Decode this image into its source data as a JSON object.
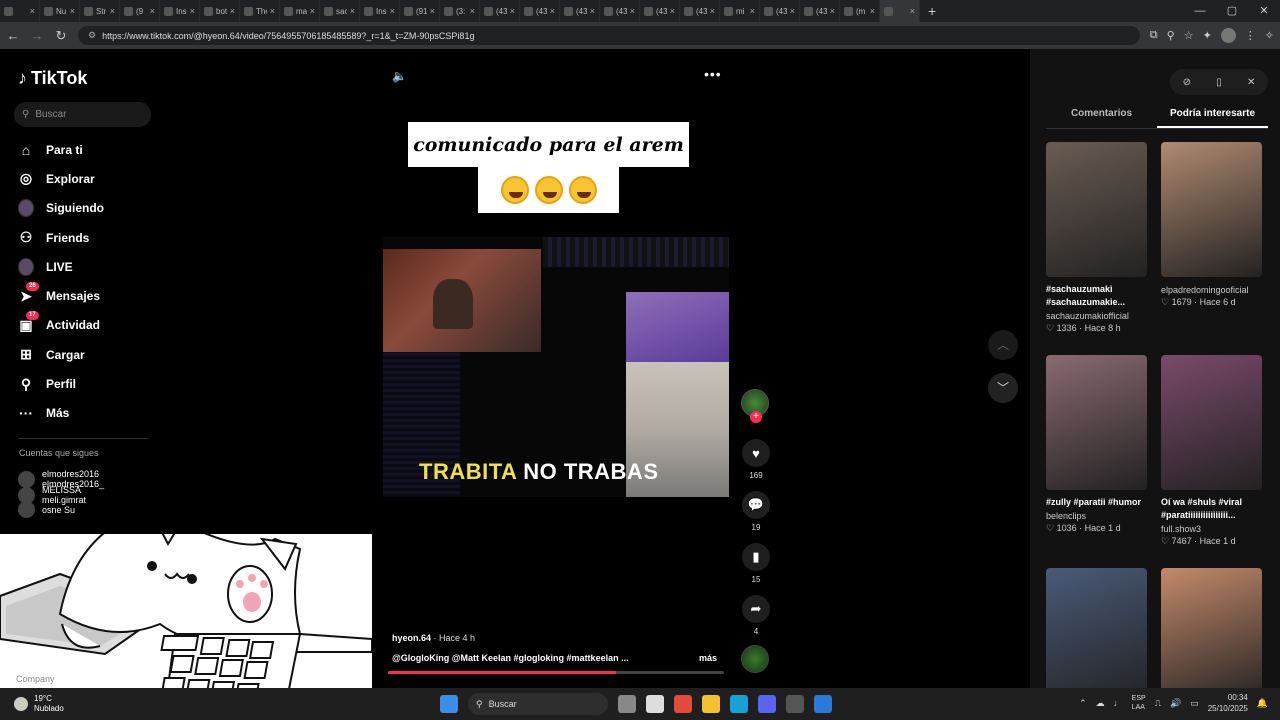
{
  "browser": {
    "tabs": [
      "",
      "Nu",
      "Str",
      "(9",
      "Ins",
      "bot",
      "The",
      "ma",
      "sac",
      "Ins",
      "(91",
      "(3:",
      "(43",
      "(43",
      "(43",
      "(43",
      "(43",
      "(43",
      "mi",
      "(43",
      "(43",
      "(m",
      ""
    ],
    "url": "https://www.tiktok.com/@hyeon.64/video/7564955706185485589?_r=1&_t=ZM-90psCSPi81g"
  },
  "sidebar": {
    "logo": "TikTok",
    "search_placeholder": "Buscar",
    "nav": [
      {
        "label": "Para ti",
        "icon": "home-icon",
        "badge": ""
      },
      {
        "label": "Explorar",
        "icon": "compass-icon",
        "badge": ""
      },
      {
        "label": "Siguiendo",
        "icon": "avatar-icon",
        "badge": ""
      },
      {
        "label": "Friends",
        "icon": "friends-icon",
        "badge": ""
      },
      {
        "label": "LIVE",
        "icon": "avatar-icon",
        "badge": ""
      },
      {
        "label": "Mensajes",
        "icon": "send-icon",
        "badge": "26"
      },
      {
        "label": "Actividad",
        "icon": "inbox-icon",
        "badge": "17"
      },
      {
        "label": "Cargar",
        "icon": "plus-square-icon",
        "badge": ""
      },
      {
        "label": "Perfil",
        "icon": "user-icon",
        "badge": ""
      },
      {
        "label": "Más",
        "icon": "more-icon",
        "badge": ""
      }
    ],
    "following_header": "Cuentas que sigues",
    "following": [
      {
        "name": "elmodres2016",
        "sub": "elmodres2016_"
      },
      {
        "name": "MELISSA",
        "sub": "meli.gimrat"
      },
      {
        "name": "osne Su",
        "sub": ""
      }
    ],
    "company": "Company"
  },
  "video": {
    "caption_line1": "comunicado para el arem",
    "subtitle_yellow": "TRABITA",
    "subtitle_white": "NO TRABAS",
    "author": "hyeon.64",
    "time": "· Hace 4 h",
    "tags": "@GlogloKing  @Matt Keelan  #glogloking  #mattkeelan  ...",
    "more": "más",
    "progress_fraction": 0.68,
    "likes": "169",
    "comments": "19",
    "saves": "15",
    "shares": "4"
  },
  "right_panel": {
    "tabs": [
      "Comentarios",
      "Podría interesarte"
    ],
    "active_tab": 1,
    "cards": [
      {
        "title": "#sachauzumaki #sachauzumakie...",
        "user": "sachauzumakiofficial",
        "meta": "♡ 1336 · Hace 8 h",
        "color": "#6a5c52"
      },
      {
        "title": "",
        "user": "elpadredomingooficial",
        "meta": "♡ 1679 · Hace 6 d",
        "color": "#b08a70"
      },
      {
        "title": "#zully #paratii #humor",
        "user": "belenclips",
        "meta": "♡ 1036 · Hace 1 d",
        "color": "#8a6a72"
      },
      {
        "title": "Oí wa #shuls #viral #paratiiiiiiiiiiiiiiii...",
        "user": "full.show3",
        "meta": "♡ 7467 · Hace 1 d",
        "color": "#7a4a6a"
      },
      {
        "title": "",
        "user": "",
        "meta": "",
        "color": "#4a5a78"
      },
      {
        "title": "",
        "user": "",
        "meta": "",
        "color": "#c48a6a"
      }
    ]
  },
  "taskbar": {
    "temp": "19°C",
    "weather": "Nublado",
    "search": "Buscar",
    "lang1": "ESP",
    "lang2": "LAA",
    "time": "00:34",
    "date": "25/10/2025"
  },
  "colors": {
    "accent": "#fe2c55",
    "subtitle_yellow": "#f0e14a"
  }
}
